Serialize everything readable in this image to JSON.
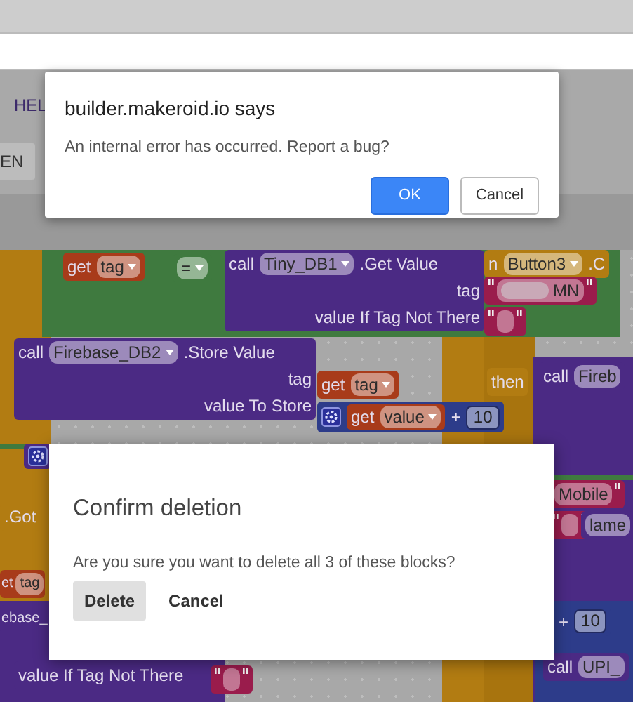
{
  "toolbar": {
    "menu_item": "HEL",
    "button": "EN"
  },
  "blocks": [
    {
      "kind": "variable",
      "rows": [
        [
          {
            "kind": "label",
            "text": "get"
          },
          {
            "kind": "dropdown",
            "text": "tag"
          }
        ]
      ]
    },
    {
      "kind": "logic",
      "rows": [
        [
          {
            "kind": "dropdown",
            "text": "="
          }
        ]
      ]
    },
    {
      "kind": "procedure",
      "rows": [
        [
          {
            "kind": "label",
            "text": "call"
          },
          {
            "kind": "dropdown",
            "text": "Tiny_DB1"
          },
          {
            "kind": "label",
            "text": ".Get Value"
          }
        ],
        [
          {
            "kind": "label",
            "text": "tag"
          }
        ],
        [
          {
            "kind": "label",
            "text": "value If Tag Not There"
          }
        ]
      ]
    },
    {
      "kind": "event",
      "rows": [
        [
          {
            "kind": "label",
            "text": "n"
          },
          {
            "kind": "dropdown",
            "text": "Button3"
          },
          {
            "kind": "label",
            "text": ".C"
          }
        ]
      ]
    },
    {
      "kind": "text",
      "rows": [
        [
          {
            "kind": "string",
            "text": "MN",
            "blurred": true
          }
        ]
      ]
    },
    {
      "kind": "text",
      "rows": [
        [
          {
            "kind": "empty_string"
          }
        ]
      ]
    },
    {
      "kind": "procedure",
      "rows": [
        [
          {
            "kind": "label",
            "text": "call"
          },
          {
            "kind": "dropdown",
            "text": "Firebase_DB2"
          },
          {
            "kind": "label",
            "text": ".Store Value"
          }
        ],
        [
          {
            "kind": "label",
            "text": "tag"
          }
        ],
        [
          {
            "kind": "label",
            "text": "value To Store"
          }
        ]
      ]
    },
    {
      "kind": "variable",
      "rows": [
        [
          {
            "kind": "label",
            "text": "get"
          },
          {
            "kind": "dropdown",
            "text": "tag"
          }
        ]
      ]
    },
    {
      "kind": "math",
      "rows": [
        [
          {
            "kind": "gear"
          },
          {
            "kind": "block",
            "block": {
              "kind": "variable",
              "rows": [
                [
                  {
                    "kind": "label",
                    "text": "get"
                  },
                  {
                    "kind": "dropdown",
                    "text": "value"
                  }
                ]
              ]
            }
          },
          {
            "kind": "label",
            "text": "+"
          },
          {
            "kind": "number",
            "text": "10"
          }
        ]
      ]
    },
    {
      "kind": "control",
      "rows": [
        [
          {
            "kind": "label",
            "text": "then"
          }
        ]
      ]
    },
    {
      "kind": "procedure",
      "rows": [
        [
          {
            "kind": "label",
            "text": "call"
          },
          {
            "kind": "field",
            "text": "Fireb"
          }
        ]
      ]
    },
    {
      "kind": "procedure",
      "rows": [
        [
          {
            "kind": "gear"
          }
        ]
      ]
    },
    {
      "kind": "event",
      "rows": [
        [
          {
            "kind": "label",
            "text": ".Got"
          }
        ]
      ]
    },
    {
      "kind": "text",
      "rows": [
        [
          {
            "kind": "string",
            "text": "Mobile"
          }
        ]
      ]
    },
    {
      "kind": "text",
      "rows": [
        [
          {
            "kind": "empty_string"
          }
        ]
      ]
    },
    {
      "kind": "procedure",
      "rows": [
        [
          {
            "kind": "field",
            "text": "lame"
          }
        ]
      ]
    },
    {
      "kind": "variable",
      "rows": [
        [
          {
            "kind": "label",
            "text": "et"
          },
          {
            "kind": "field",
            "text": "tag"
          }
        ]
      ]
    },
    {
      "kind": "procedure",
      "rows": [
        [
          {
            "kind": "label",
            "text": "ebase_"
          }
        ]
      ]
    },
    {
      "kind": "math",
      "rows": [
        [
          {
            "kind": "label",
            "text": "+"
          },
          {
            "kind": "number",
            "text": "10"
          }
        ]
      ]
    },
    {
      "kind": "procedure",
      "rows": [
        [
          {
            "kind": "label",
            "text": "call"
          },
          {
            "kind": "field",
            "text": "UPI_"
          }
        ]
      ]
    },
    {
      "kind": "procedure",
      "rows": [
        [
          {
            "kind": "label",
            "text": "value If Tag Not There"
          }
        ]
      ]
    },
    {
      "kind": "text",
      "rows": [
        [
          {
            "kind": "empty_string"
          }
        ]
      ]
    }
  ],
  "alert": {
    "title": "builder.makeroid.io says",
    "message": "An internal error has occurred. Report a bug?",
    "buttons": [
      {
        "label": "OK",
        "primary": true
      },
      {
        "label": "Cancel",
        "primary": false
      }
    ]
  },
  "confirm": {
    "title": "Confirm deletion",
    "message": "Are you sure you want to delete all 3 of these blocks?",
    "buttons": [
      {
        "label": "Delete",
        "kind": "filled"
      },
      {
        "label": "Cancel",
        "kind": "text"
      }
    ]
  }
}
